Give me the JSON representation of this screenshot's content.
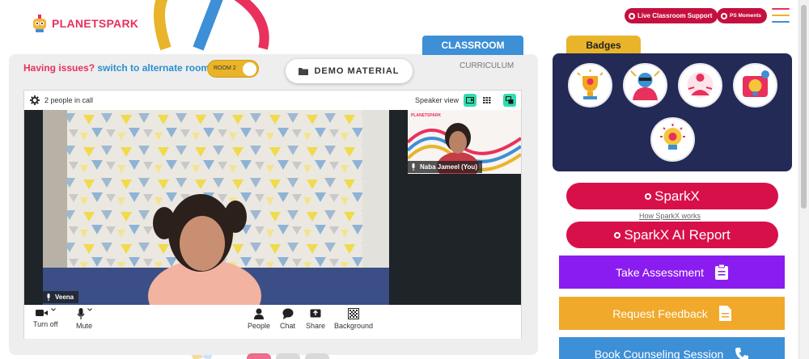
{
  "logo": {
    "brand_part1": "PLANET",
    "brand_part2": "SPARK"
  },
  "header": {
    "live_support_label": "Live Classroom Support",
    "ps_moments_label": "PS Moments"
  },
  "classroom": {
    "issue_question": "Having issues?",
    "issue_action": "switch to alternate room",
    "room_toggle_label": "ROOM 2",
    "demo_material_label": "DEMO MATERIAL",
    "tabs": [
      {
        "label": "CLASSROOM",
        "active": true
      },
      {
        "label": "CURRICULUM",
        "active": false
      }
    ]
  },
  "call": {
    "people_count_label": "2 people in call",
    "view_label": "Speaker view",
    "main_participant": "Veena",
    "self_participant": "Naba Jameel (You)",
    "self_feed_logo": "PLANETSPARK",
    "controls": [
      {
        "label": "Turn off",
        "icon": "video-camera-icon"
      },
      {
        "label": "Mute",
        "icon": "microphone-icon"
      },
      {
        "label": "People",
        "icon": "person-icon"
      },
      {
        "label": "Chat",
        "icon": "chat-bubble-icon"
      },
      {
        "label": "Share",
        "icon": "share-screen-icon"
      },
      {
        "label": "Background",
        "icon": "background-icon"
      }
    ]
  },
  "side": {
    "badges_title": "Badges",
    "sparkx_label": "SparkX",
    "how_sparkx_label": "How SparkX works",
    "sparkx_ai_label": "SparkX AI Report",
    "take_assessment_label": "Take Assessment",
    "request_feedback_label": "Request Feedback",
    "book_counseling_label": "Book Counseling Session"
  },
  "colors": {
    "brand_red": "#d8104a",
    "brand_blue": "#3d8fd6",
    "brand_yellow": "#e9b42a",
    "purple": "#8a1cf0",
    "navy": "#232a55",
    "teal_active": "#2fdcb0"
  }
}
